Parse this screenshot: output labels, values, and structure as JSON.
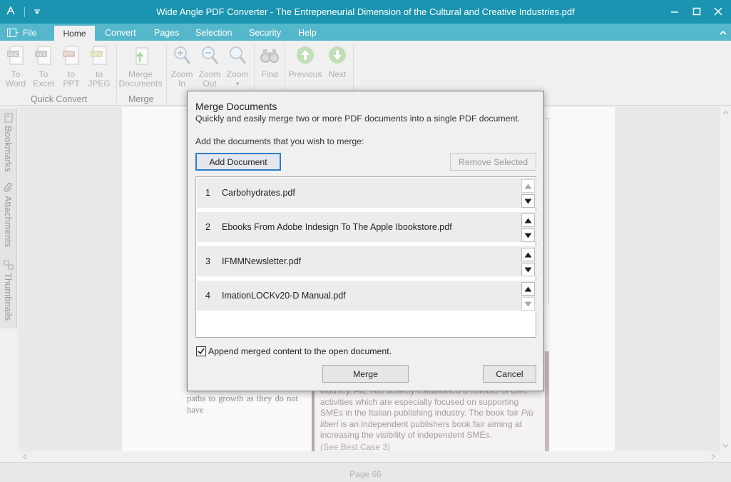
{
  "window": {
    "title": "Wide Angle PDF Converter - The Entrepeneurial Dimension of the Cultural and Creative Industries.pdf",
    "controls": {
      "minimize": "—",
      "maximize": "☐",
      "close": "✕"
    }
  },
  "menu": {
    "file": "File",
    "tabs": [
      "Home",
      "Convert",
      "Pages",
      "Selection",
      "Security",
      "Help"
    ],
    "active_tab": "Home"
  },
  "ribbon": {
    "quick_convert": {
      "label": "Quick Convert",
      "buttons": [
        {
          "line1": "To",
          "line2": "Word",
          "icon": "doc-icon",
          "badge": "DOC"
        },
        {
          "line1": "To",
          "line2": "Excel",
          "icon": "xls-icon",
          "badge": "XLS"
        },
        {
          "line1": "to",
          "line2": "PPT",
          "icon": "ppt-icon",
          "badge": "PPT"
        },
        {
          "line1": "to",
          "line2": "JPEG",
          "icon": "jpg-icon",
          "badge": "JPG"
        }
      ]
    },
    "merge": {
      "label": "Merge",
      "button": {
        "line1": "Merge",
        "line2": "Documents"
      }
    },
    "zoom": [
      {
        "line1": "Zoom",
        "line2": "In"
      },
      {
        "line1": "Zoom",
        "line2": "Out"
      },
      {
        "line1": "Zoom",
        "line2": "▾"
      }
    ],
    "find": "Find",
    "previous": "Previous",
    "next": "Next"
  },
  "side_tabs": [
    "Bookmarks",
    "Attachments",
    "Thumbnails"
  ],
  "document": {
    "left_column": "infrastructures for research and development activities while, on the other hand, micro-SMEs do not have access to similar paths to growth as they do not have",
    "box_text_pre": "industry. AIE has actively established a number of core activities which are especially focused on supporting SMEs in the Italian publishing industry. The book fair ",
    "box_text_em": "Più liberi",
    "box_text_post": " is an independent publishers book fair aiming at increasing the visibility of independent SMEs.",
    "box_cite": "(See Best Case 3)"
  },
  "dialog": {
    "title": "Merge Documents",
    "subtitle": "Quickly and easily merge two or more PDF documents into a single PDF document.",
    "prompt": "Add the documents that you wish to merge:",
    "add_button": "Add Document",
    "remove_button": "Remove Selected",
    "files": [
      {
        "index": "1",
        "name": "Carbohydrates.pdf"
      },
      {
        "index": "2",
        "name": "Ebooks From Adobe Indesign To The Apple Ibookstore.pdf"
      },
      {
        "index": "3",
        "name": "IFMMNewsletter.pdf"
      },
      {
        "index": "4",
        "name": "ImationLOCKv20-D Manual.pdf"
      }
    ],
    "append_label": "Append merged content to the open document.",
    "append_checked": true,
    "merge_button": "Merge",
    "cancel_button": "Cancel"
  },
  "status": {
    "page": "Page 66"
  },
  "colors": {
    "titlebar": "#1a94b0",
    "menubar": "#55b7cb",
    "accent": "#2c7ec6"
  }
}
